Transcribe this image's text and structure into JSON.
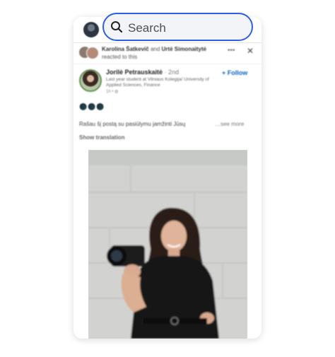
{
  "search": {
    "placeholder": "Search"
  },
  "reaction": {
    "name1": "Karolina Šatkevič",
    "connector": "and",
    "name2": "Urtė Simonaitytė",
    "suffix": "reacted to this"
  },
  "post": {
    "author": "Jorilė Petrauskaitė",
    "degree": "· 2nd",
    "bio": "Last year student at Vilniaus Kolegija/ University of Applied Sciences, Finance",
    "meta": "1h • ◍",
    "follow_label": "+ Follow",
    "emojis": "🌑🌑🌑",
    "text": "Rašau šį postą su pasiūlymu jamžinti Jūsų",
    "see_more": "…see more",
    "show_translation": "Show translation"
  },
  "colors": {
    "accent": "#2f5fe0",
    "link": "#0a66c2"
  }
}
